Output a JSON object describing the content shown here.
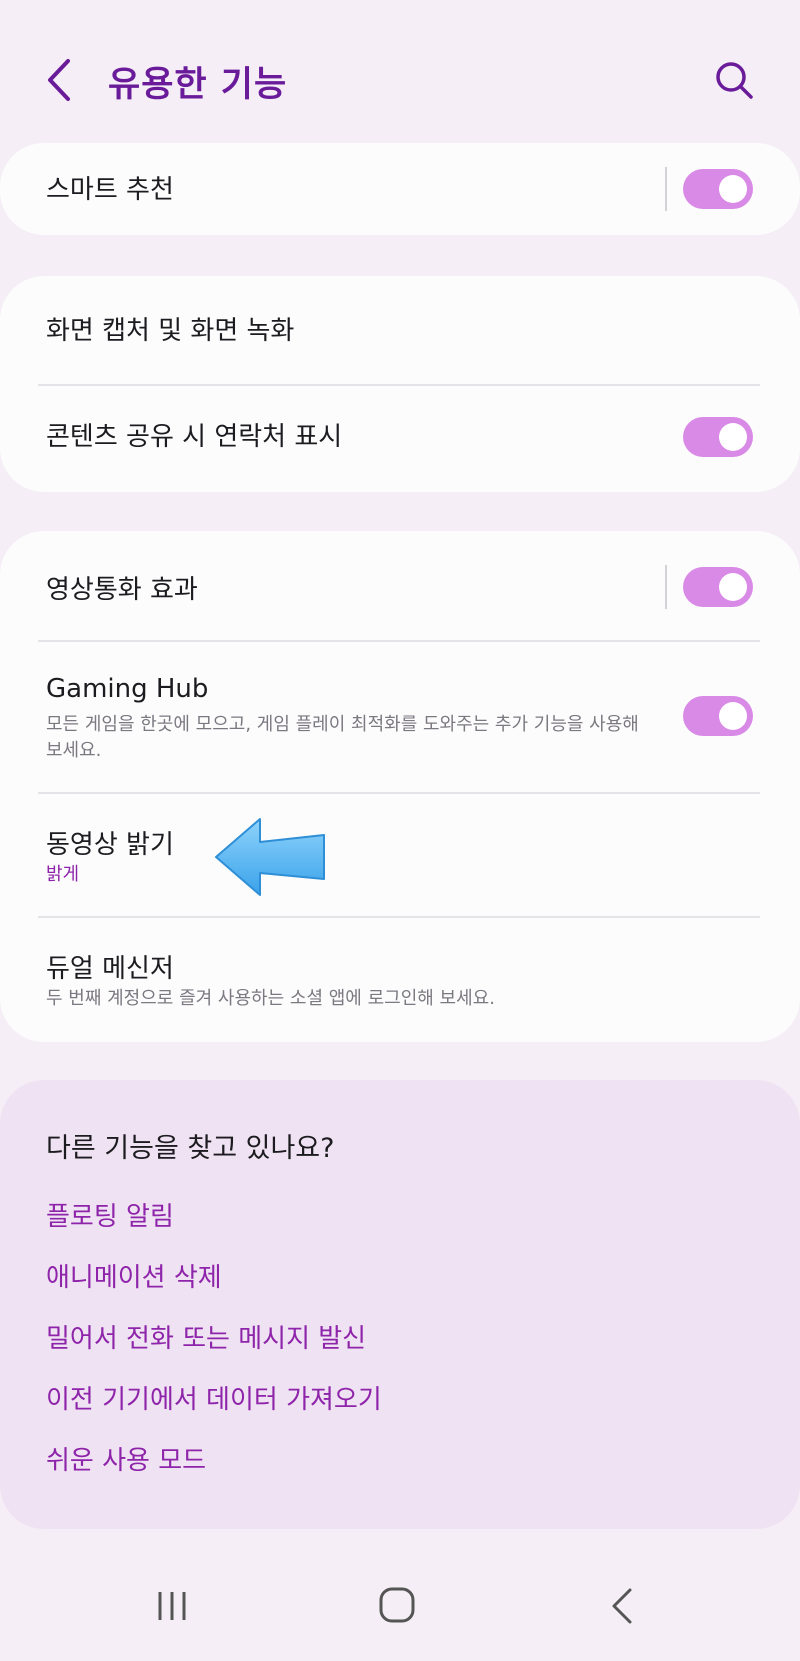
{
  "header": {
    "back_icon": "chevron-left-icon",
    "title": "유용한 기능",
    "search_icon": "search-icon"
  },
  "colors": {
    "background": "#f5eef6",
    "card": "#fcfcfd",
    "accent": "#8e24aa",
    "title": "#6a1b9a",
    "toggle_on": "#d98ae6",
    "suggest_bg": "#efe2f2"
  },
  "cards": [
    {
      "rows": [
        {
          "title": "스마트 추천",
          "toggle": true
        }
      ]
    },
    {
      "rows": [
        {
          "title": "화면 캡처 및 화면 녹화"
        },
        {
          "title": "콘텐츠 공유 시 연락처 표시",
          "toggle": true
        }
      ]
    },
    {
      "rows": [
        {
          "title": "영상통화 효과",
          "toggle": true
        },
        {
          "title": "Gaming Hub",
          "subtitle": "모든 게임을 한곳에 모으고, 게임 플레이 최적화를 도와주는 추가 기능을 사용해 보세요.",
          "toggle": true
        },
        {
          "title": "동영상 밝기",
          "subtitle": "밝게"
        },
        {
          "title": "듀얼 메신저",
          "subtitle": "두 번째 계정으로 즐겨 사용하는 소셜 앱에 로그인해 보세요."
        }
      ]
    }
  ],
  "suggestions": {
    "heading": "다른 기능을 찾고 있나요?",
    "links": [
      "플로팅 알림",
      "애니메이션 삭제",
      "밀어서 전화 또는 메시지 발신",
      "이전 기기에서 데이터 가져오기",
      "쉬운 사용 모드"
    ]
  },
  "annotation": {
    "icon": "arrow-left-icon",
    "color": "#4fb3f0"
  },
  "navbar": {
    "recent_icon": "recent-apps-icon",
    "home_icon": "home-icon",
    "back_icon": "back-icon"
  }
}
